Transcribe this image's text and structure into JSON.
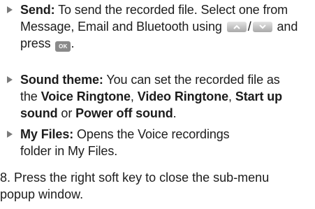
{
  "items": [
    {
      "label": "Send:",
      "text_1": "To send the recorded file. Select one from Message, Email and Bluetooth using",
      "slash": "/",
      "text_2": "and press",
      "icons": [
        "up-key-icon",
        "down-key-icon",
        "ok-key-icon"
      ],
      "ok_key_label": "OK"
    },
    {
      "label": "Sound theme:",
      "text_1": "You can set the recorded file as the",
      "opt1": "Voice Ringtone",
      "sep1": ",",
      "opt2": "Video Ringtone",
      "sep2": ",",
      "opt3": "Start up sound",
      "sep3": "or",
      "opt4": "Power off sound",
      "end": "."
    },
    {
      "label": "My Files:",
      "text_1": "Opens the Voice recordings folder in My Files."
    }
  ],
  "step8": {
    "number": "8.",
    "text": "Press the right soft key to close the sub-menu popup window."
  },
  "colors": {
    "text": "#1c1c1c",
    "bullet": "#7a7a7a",
    "key_gradient_top": "#e4e4e4",
    "key_gradient_bottom": "#a9a9a9",
    "ok_key": "#8a8a8a"
  }
}
